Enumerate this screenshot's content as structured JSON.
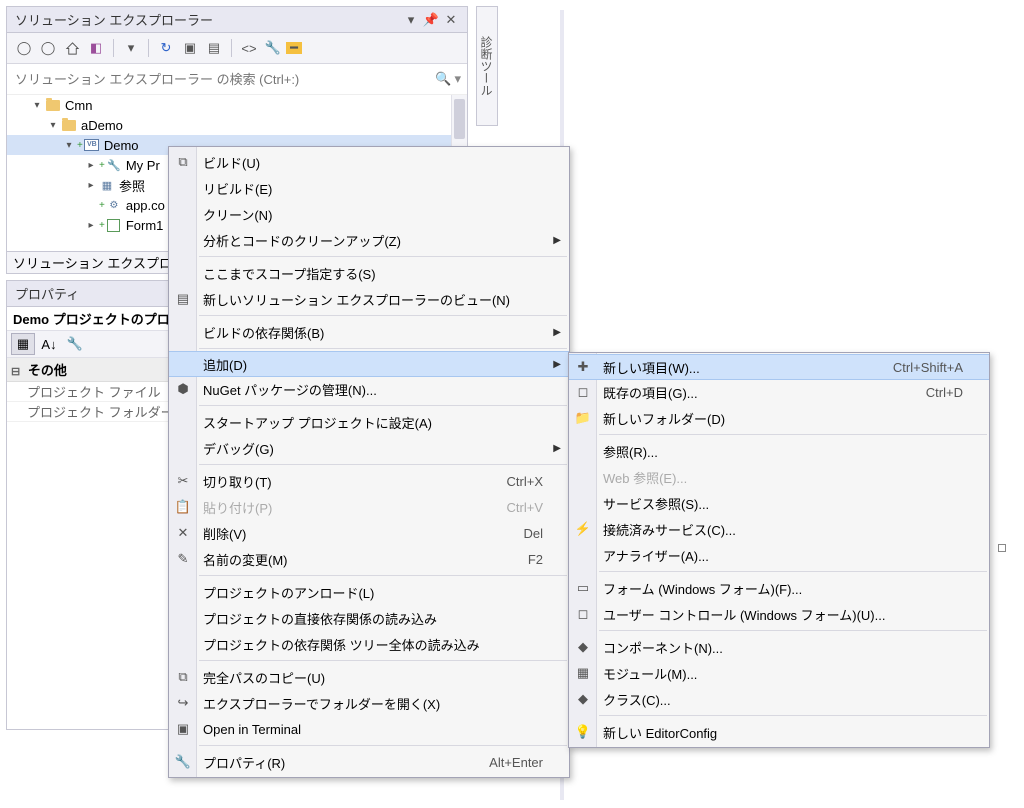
{
  "solution_explorer": {
    "title": "ソリューション エクスプローラー",
    "search_placeholder": "ソリューション エクスプローラー の検索 (Ctrl+:)",
    "tab_label": "ソリューション エクスプローラー",
    "tree": {
      "root": "Cmn",
      "aDemo": "aDemo",
      "demo": "Demo",
      "myproject": "My Pr",
      "references": "参照",
      "appconfig": "app.co",
      "form1": "Form1"
    }
  },
  "side_tab": "診断ツール",
  "properties": {
    "title": "プロパティ",
    "header": "Demo プロジェクトのプロパ",
    "section_other": "その他",
    "row_file": "プロジェクト ファイル",
    "row_folder": "プロジェクト フォルダー"
  },
  "context_menu1": [
    {
      "icon": "build",
      "label": "ビルド(U)"
    },
    {
      "label": "リビルド(E)"
    },
    {
      "label": "クリーン(N)"
    },
    {
      "label": "分析とコードのクリーンアップ(Z)",
      "arrow": true
    },
    {
      "sep": true
    },
    {
      "label": "ここまでスコープ指定する(S)"
    },
    {
      "icon": "newview",
      "label": "新しいソリューション エクスプローラーのビュー(N)"
    },
    {
      "sep": true
    },
    {
      "label": "ビルドの依存関係(B)",
      "arrow": true
    },
    {
      "sep": true
    },
    {
      "label": "追加(D)",
      "arrow": true,
      "highlighted": true
    },
    {
      "icon": "nuget",
      "label": "NuGet パッケージの管理(N)..."
    },
    {
      "sep": true
    },
    {
      "label": "スタートアップ プロジェクトに設定(A)"
    },
    {
      "label": "デバッグ(G)",
      "arrow": true
    },
    {
      "sep": true
    },
    {
      "icon": "cut",
      "label": "切り取り(T)",
      "shortcut": "Ctrl+X"
    },
    {
      "icon": "paste",
      "label": "貼り付け(P)",
      "shortcut": "Ctrl+V",
      "disabled": true
    },
    {
      "icon": "delete",
      "label": "削除(V)",
      "shortcut": "Del"
    },
    {
      "icon": "rename",
      "label": "名前の変更(M)",
      "shortcut": "F2"
    },
    {
      "sep": true
    },
    {
      "label": "プロジェクトのアンロード(L)"
    },
    {
      "label": "プロジェクトの直接依存関係の読み込み"
    },
    {
      "label": "プロジェクトの依存関係 ツリー全体の読み込み"
    },
    {
      "sep": true
    },
    {
      "icon": "copy",
      "label": "完全パスのコピー(U)"
    },
    {
      "icon": "openfolder",
      "label": "エクスプローラーでフォルダーを開く(X)"
    },
    {
      "icon": "terminal",
      "label": "Open in Terminal"
    },
    {
      "sep": true
    },
    {
      "icon": "wrench",
      "label": "プロパティ(R)",
      "shortcut": "Alt+Enter"
    }
  ],
  "context_menu2": [
    {
      "icon": "newitem",
      "label": "新しい項目(W)...",
      "shortcut": "Ctrl+Shift+A",
      "highlighted": true
    },
    {
      "icon": "existitem",
      "label": "既存の項目(G)...",
      "shortcut": "Ctrl+D"
    },
    {
      "icon": "newfolder",
      "label": "新しいフォルダー(D)"
    },
    {
      "sep": true
    },
    {
      "label": "参照(R)..."
    },
    {
      "label": "Web 参照(E)...",
      "disabled": true
    },
    {
      "label": "サービス参照(S)..."
    },
    {
      "icon": "connected",
      "label": "接続済みサービス(C)..."
    },
    {
      "label": "アナライザー(A)..."
    },
    {
      "sep": true
    },
    {
      "icon": "form",
      "label": "フォーム (Windows フォーム)(F)..."
    },
    {
      "icon": "usercontrol",
      "label": "ユーザー コントロール (Windows フォーム)(U)..."
    },
    {
      "sep": true
    },
    {
      "icon": "component",
      "label": "コンポーネント(N)..."
    },
    {
      "icon": "module",
      "label": "モジュール(M)..."
    },
    {
      "icon": "class",
      "label": "クラス(C)..."
    },
    {
      "sep": true
    },
    {
      "icon": "bulb",
      "label": "新しい EditorConfig"
    }
  ]
}
